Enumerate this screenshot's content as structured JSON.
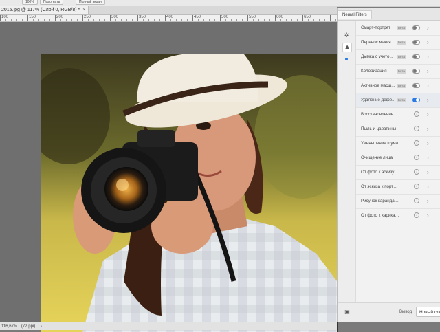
{
  "options_bar": {
    "buttons": [
      "100%",
      "Подогнать",
      "Полный экран"
    ]
  },
  "document": {
    "tab_title": "2015.jpg @ 117% (Слой 0, RGB/8) *",
    "close_glyph": "×"
  },
  "ruler": {
    "numbers": [
      "100",
      "150",
      "200",
      "250",
      "300",
      "350",
      "400",
      "450",
      "500",
      "550",
      "600",
      "650"
    ]
  },
  "status_bar": {
    "zoom": "116,67%",
    "doc_info": "(72 ppi)",
    "chevron": "›"
  },
  "neural_filters": {
    "title": "Neural Filters",
    "rail_icons": [
      "star-icon",
      "portrait-icon"
    ],
    "filters": [
      {
        "label": "Смарт-портрет",
        "beta": "Бета",
        "control": "toggle",
        "on": false
      },
      {
        "label": "Перенос макия...",
        "beta": "Бета",
        "control": "toggle",
        "on": false
      },
      {
        "label": "Дымка с учето...",
        "beta": "Бета",
        "control": "toggle",
        "on": false
      },
      {
        "label": "Колоризация",
        "beta": "Бета",
        "control": "toggle",
        "on": false
      },
      {
        "label": "Активное масш...",
        "beta": "Бета",
        "control": "toggle",
        "on": false
      },
      {
        "label": "Удаление дефе...",
        "beta": "Бета",
        "control": "toggle",
        "on": true
      },
      {
        "label": "Восстановление фот...",
        "beta": "",
        "control": "download",
        "on": false
      },
      {
        "label": "Пыль и царапины",
        "beta": "",
        "control": "download",
        "on": false
      },
      {
        "label": "Уменьшение шума",
        "beta": "",
        "control": "download",
        "on": false
      },
      {
        "label": "Очищение лица",
        "beta": "",
        "control": "download",
        "on": false
      },
      {
        "label": "От фото к эскизу",
        "beta": "",
        "control": "download",
        "on": false
      },
      {
        "label": "От эскиза к портрету",
        "beta": "",
        "control": "download",
        "on": false
      },
      {
        "label": "Рисунок карандашом",
        "beta": "",
        "control": "download",
        "on": false
      },
      {
        "label": "От фото к карикатуре",
        "beta": "",
        "control": "download",
        "on": false
      }
    ],
    "chevron": "›",
    "download_glyph": "↓",
    "footer": {
      "output_label": "Вывод",
      "output_value": "Новый слой"
    }
  },
  "colors": {
    "accent": "#2c7be5",
    "panel_bg": "#f2f2f2",
    "workspace_bg": "#6f6f6f"
  }
}
